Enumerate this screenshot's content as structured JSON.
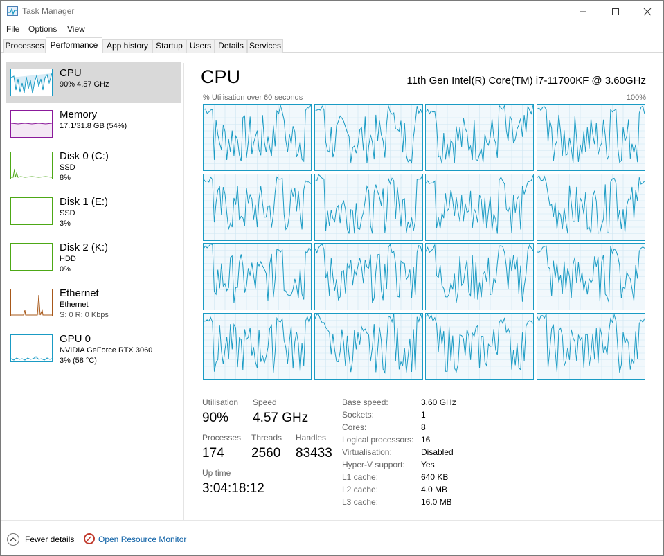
{
  "window": {
    "title": "Task Manager"
  },
  "menu": [
    "File",
    "Options",
    "View"
  ],
  "tabs": [
    "Processes",
    "Performance",
    "App history",
    "Startup",
    "Users",
    "Details",
    "Services"
  ],
  "active_tab": "Performance",
  "resources": [
    {
      "name": "CPU",
      "line1": "90%  4.57 GHz",
      "line2": "",
      "color": "#1a9bc4",
      "selected": true
    },
    {
      "name": "Memory",
      "line1": "17.1/31.8 GB (54%)",
      "line2": "",
      "color": "#8b1a9b",
      "selected": false
    },
    {
      "name": "Disk 0 (C:)",
      "line1": "SSD",
      "line2": "8%",
      "color": "#4da816",
      "selected": false
    },
    {
      "name": "Disk 1 (E:)",
      "line1": "SSD",
      "line2": "3%",
      "color": "#4da816",
      "selected": false
    },
    {
      "name": "Disk 2 (K:)",
      "line1": "HDD",
      "line2": "0%",
      "color": "#4da816",
      "selected": false
    },
    {
      "name": "Ethernet",
      "line1": "Ethernet",
      "line2": "S: 0  R: 0 Kbps",
      "color": "#a7581a",
      "selected": false
    },
    {
      "name": "GPU 0",
      "line1": "NVIDIA GeForce RTX 3060",
      "line2": "3% (58 °C)",
      "color": "#1a9bc4",
      "selected": false
    }
  ],
  "cpu": {
    "title": "CPU",
    "model": "11th Gen Intel(R) Core(TM) i7-11700KF @ 3.60GHz",
    "graph_caption": "% Utilisation over 60 seconds",
    "graph_max": "100%",
    "logical_processor_graphs": 16,
    "stats": {
      "utilisation_label": "Utilisation",
      "utilisation": "90%",
      "speed_label": "Speed",
      "speed": "4.57 GHz",
      "processes_label": "Processes",
      "processes": "174",
      "threads_label": "Threads",
      "threads": "2560",
      "handles_label": "Handles",
      "handles": "83433",
      "uptime_label": "Up time",
      "uptime": "3:04:18:12"
    },
    "specs": [
      {
        "label": "Base speed:",
        "value": "3.60 GHz"
      },
      {
        "label": "Sockets:",
        "value": "1"
      },
      {
        "label": "Cores:",
        "value": "8"
      },
      {
        "label": "Logical processors:",
        "value": "16"
      },
      {
        "label": "Virtualisation:",
        "value": "Disabled"
      },
      {
        "label": "Hyper-V support:",
        "value": "Yes"
      },
      {
        "label": "L1 cache:",
        "value": "640 KB"
      },
      {
        "label": "L2 cache:",
        "value": "4.0 MB"
      },
      {
        "label": "L3 cache:",
        "value": "16.0 MB"
      }
    ]
  },
  "footer": {
    "fewer_details": "Fewer details",
    "open_resmon": "Open Resource Monitor"
  },
  "colors": {
    "cpu_line": "#1a9bc4",
    "cpu_fill": "#f1f8fc",
    "selected_bg": "#d9d9d9",
    "link": "#0b5fa5"
  },
  "icons": [
    "task-manager-icon",
    "minimize-icon",
    "maximize-icon",
    "close-icon",
    "chevron-up-icon",
    "resource-monitor-icon"
  ]
}
